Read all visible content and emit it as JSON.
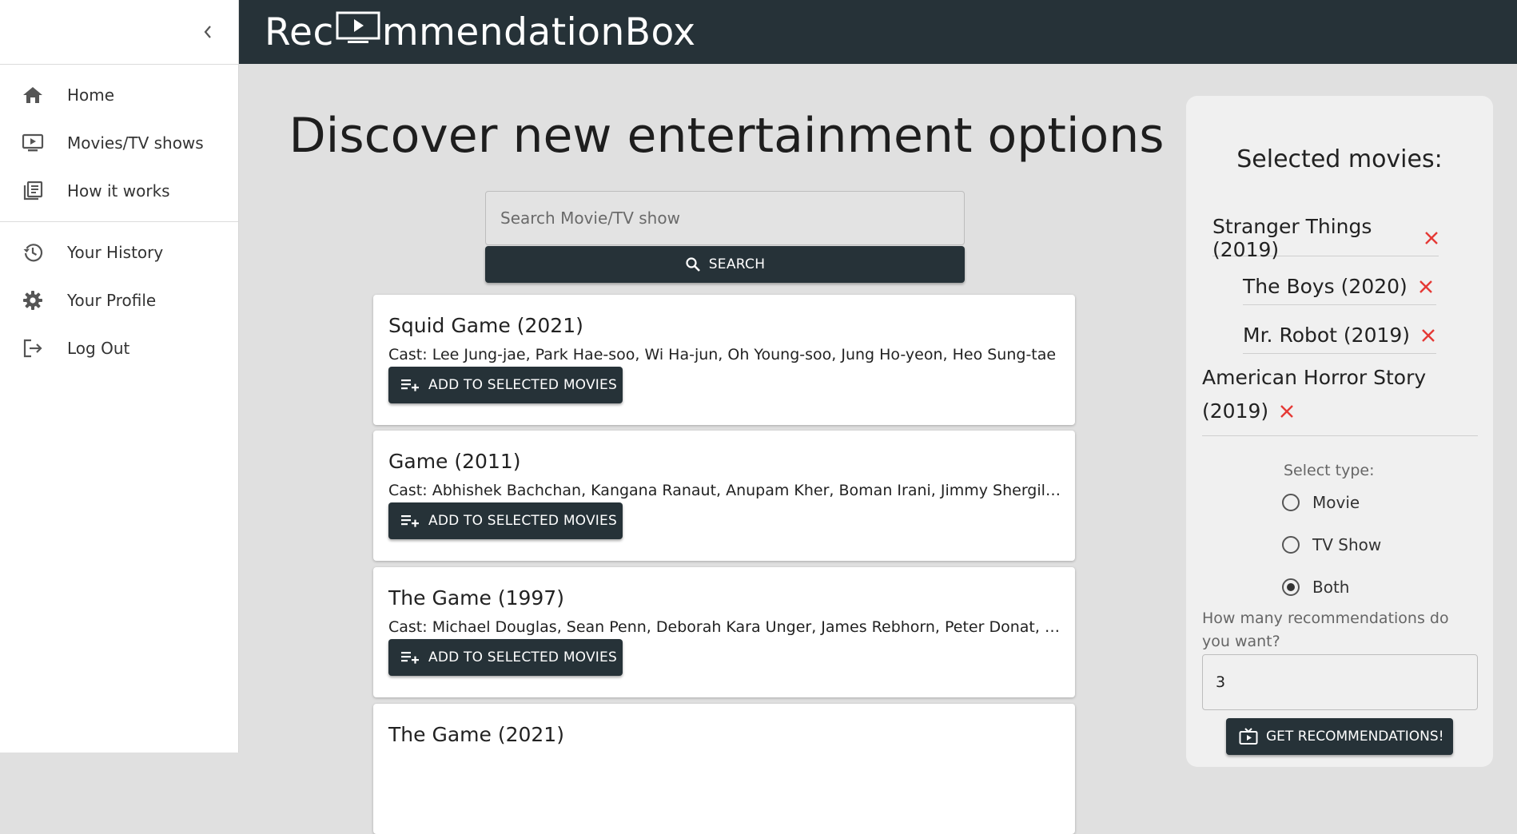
{
  "app": {
    "logo_before": "Rec",
    "logo_after": "mmendationBox"
  },
  "sidebar": {
    "primary": [
      {
        "label": "Home",
        "icon": "home-icon"
      },
      {
        "label": "Movies/TV shows",
        "icon": "tv-play-icon"
      },
      {
        "label": "How it works",
        "icon": "library-books-icon"
      }
    ],
    "secondary": [
      {
        "label": "Your History",
        "icon": "history-icon"
      },
      {
        "label": "Your Profile",
        "icon": "gear-icon"
      },
      {
        "label": "Log Out",
        "icon": "logout-icon"
      }
    ]
  },
  "main": {
    "heading": "Discover new entertainment options",
    "search_placeholder": "Search Movie/TV show",
    "search_button": "SEARCH",
    "add_button": "ADD TO SELECTED MOVIES",
    "results": [
      {
        "title": "Squid Game (2021)",
        "cast": "Cast: Lee Jung-jae, Park Hae-soo, Wi Ha-jun, Oh Young-soo, Jung Ho-yeon, Heo Sung-tae"
      },
      {
        "title": "Game (2011)",
        "cast": "Cast: Abhishek Bachchan, Kangana Ranaut, Anupam Kher, Boman Irani, Jimmy Shergill, Sarah-Jane Dias"
      },
      {
        "title": "The Game (1997)",
        "cast": "Cast: Michael Douglas, Sean Penn, Deborah Kara Unger, James Rebhorn, Peter Donat, Carroll Baker"
      },
      {
        "title": "The Game (2021)",
        "cast": ""
      }
    ]
  },
  "panel": {
    "title": "Selected movies:",
    "selected": [
      {
        "title": "Stranger Things (2019)"
      },
      {
        "title": "The Boys (2020)"
      },
      {
        "title": "Mr. Robot (2019)"
      },
      {
        "title_line1": "American Horror Story",
        "title_line2": "(2019)"
      }
    ],
    "type_label": "Select type:",
    "types": [
      {
        "label": "Movie",
        "selected": false
      },
      {
        "label": "TV Show",
        "selected": false
      },
      {
        "label": "Both",
        "selected": true
      }
    ],
    "count_label": "How many recommendations do you want?",
    "count_value": "3",
    "recommend_button": "GET RECOMMENDATIONS!"
  },
  "colors": {
    "dark": "#263238",
    "remove_x": "#e53935",
    "background": "#e0e0e0"
  }
}
